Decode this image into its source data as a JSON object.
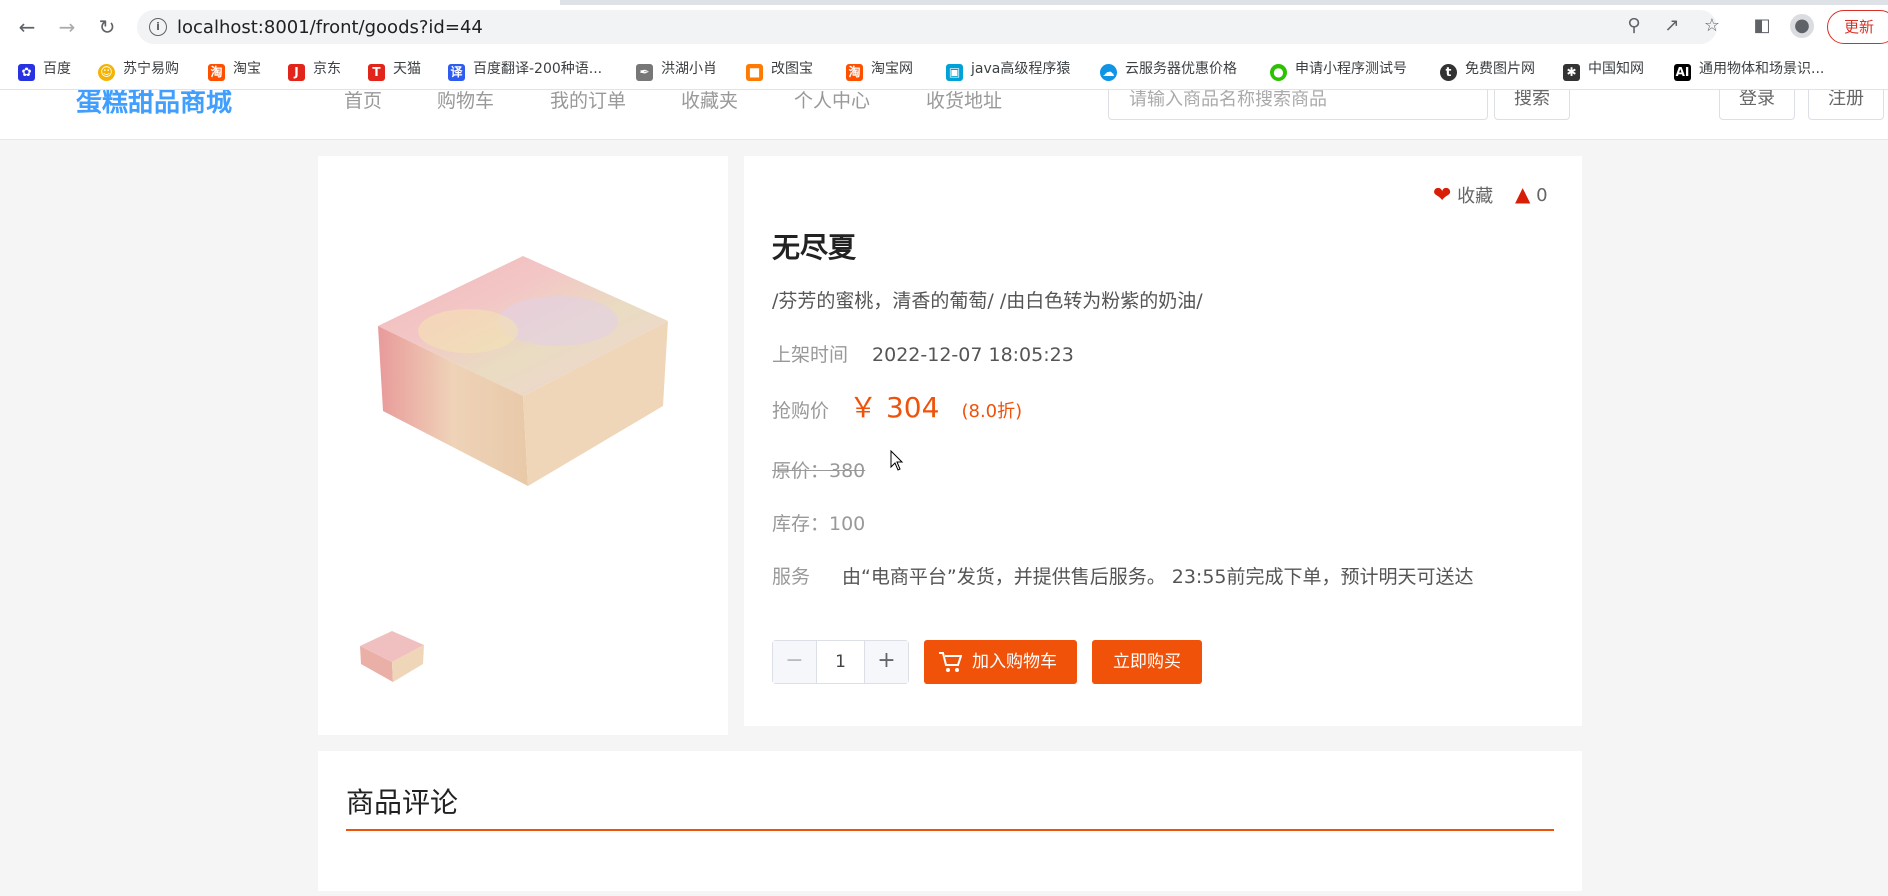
{
  "browser": {
    "url": "localhost:8001/front/goods?id=44",
    "update_label": "更新",
    "bookmarks": [
      {
        "label": "百度",
        "icon": "baidu-paw-icon",
        "color": "#2932e1"
      },
      {
        "label": "苏宁易购",
        "icon": "suning-lion-icon",
        "color": "#f5b400"
      },
      {
        "label": "淘宝",
        "icon": "taobao-icon",
        "color": "#ff5000"
      },
      {
        "label": "京东",
        "icon": "jd-icon",
        "color": "#e1251b"
      },
      {
        "label": "天猫",
        "icon": "tmall-icon",
        "color": "#e1251b"
      },
      {
        "label": "百度翻译-200种语...",
        "icon": "baidu-translate-icon",
        "color": "#2f5cf0"
      },
      {
        "label": "洪湖小肖",
        "icon": "feather-icon",
        "color": "#555555"
      },
      {
        "label": "改图宝",
        "icon": "gaitubao-icon",
        "color": "#ff7a00"
      },
      {
        "label": "淘宝网",
        "icon": "taobao-icon",
        "color": "#ff5000"
      },
      {
        "label": "java高级程序猿",
        "icon": "bilibili-icon",
        "color": "#00a1d6"
      },
      {
        "label": "云服务器优惠价格",
        "icon": "cloud-icon",
        "color": "#0f94e6"
      },
      {
        "label": "申请小程序测试号",
        "icon": "wechat-icon",
        "color": "#2dc100"
      },
      {
        "label": "免费图片网",
        "icon": "t-icon",
        "color": "#333333"
      },
      {
        "label": "中国知网",
        "icon": "cnki-icon",
        "color": "#333333"
      },
      {
        "label": "通用物体和场景识...",
        "icon": "ai-icon",
        "color": "#000000"
      }
    ]
  },
  "site": {
    "logo": "蛋糕甜品商城",
    "menu": [
      "首页",
      "购物车",
      "我的订单",
      "收藏夹",
      "个人中心",
      "收货地址"
    ],
    "search_placeholder": "请输入商品名称搜索商品",
    "search_button": "搜索",
    "login": "登录",
    "register": "注册"
  },
  "product": {
    "favorite_label": "收藏",
    "like_count": "0",
    "name": "无尽夏",
    "description": "/芬芳的蜜桃，清香的葡萄/ /由白色转为粉紫的奶油/",
    "listed_label": "上架时间",
    "listed_time": "2022-12-07 18:05:23",
    "price_label": "抢购价",
    "price": "￥ 304",
    "discount": "(8.0折)",
    "original_price": "原价：380",
    "stock": "库存：100",
    "service_label": "服务",
    "service_text": "由“电商平台”发货，并提供售后服务。 23:55前完成下单，预计明天可送达",
    "quantity": "1",
    "add_to_cart": "加入购物车",
    "buy_now": "立即购买"
  },
  "reviews": {
    "title": "商品评论"
  },
  "colors": {
    "accent": "#f0520a",
    "logo": "#409eff",
    "favorite": "#d81e06"
  }
}
